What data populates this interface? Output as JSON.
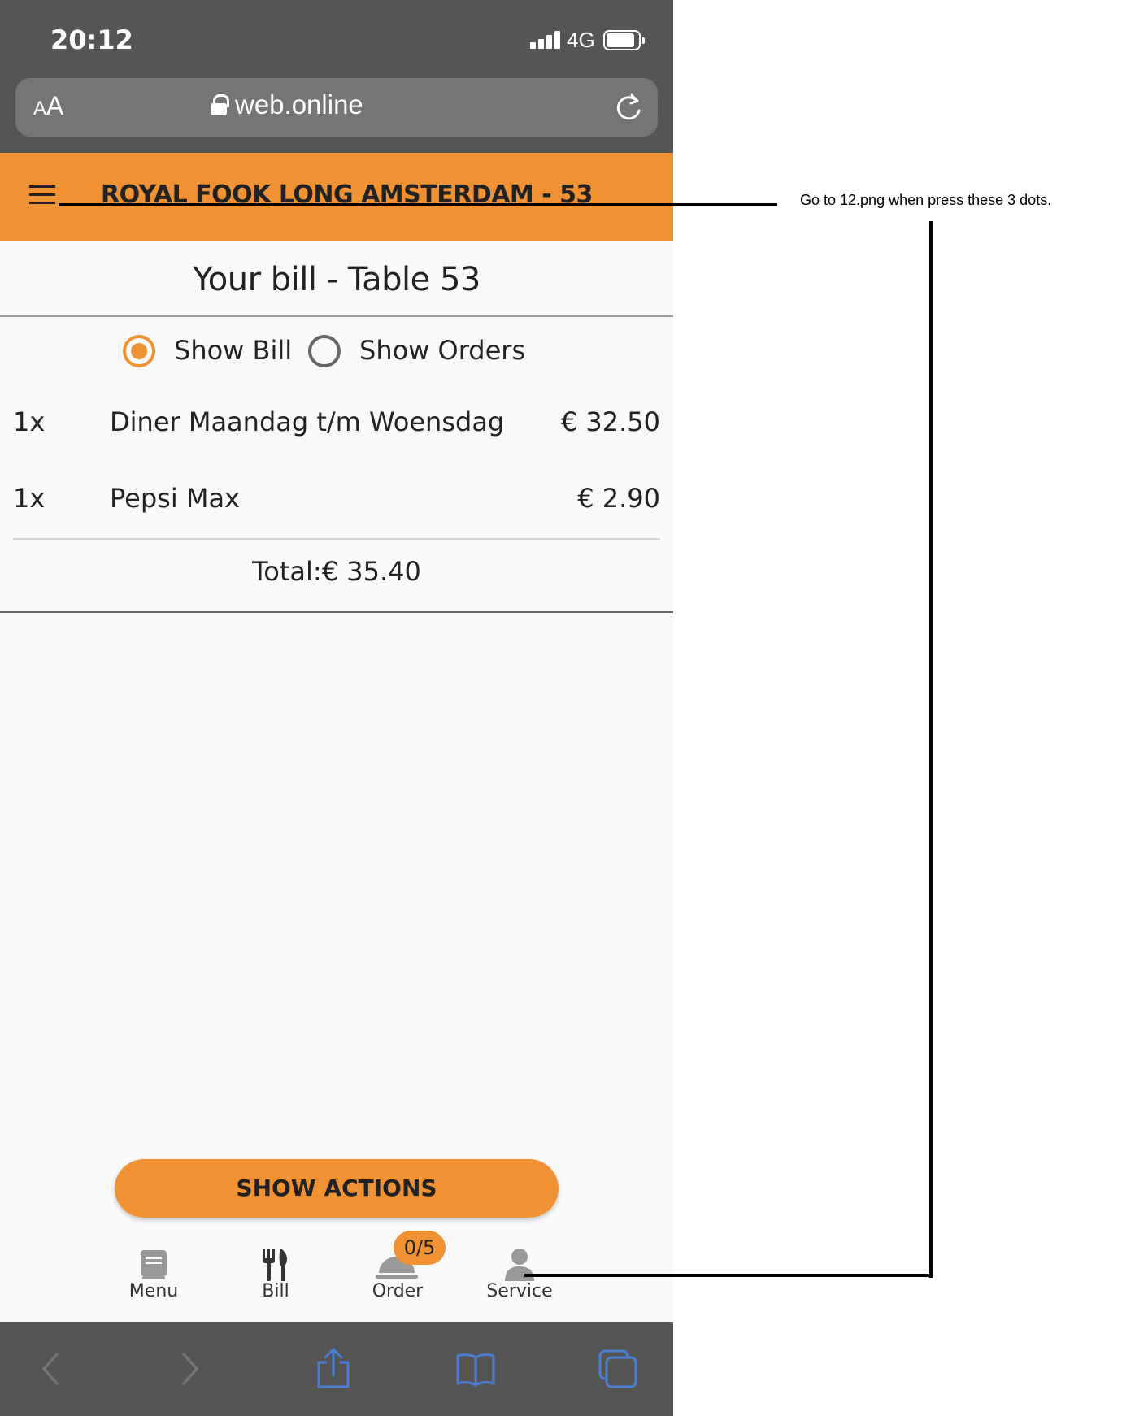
{
  "status_bar": {
    "time": "20:12",
    "network": "4G"
  },
  "browser": {
    "text_size_label_small": "A",
    "text_size_label_large": "A",
    "url": "web.online"
  },
  "app_header": {
    "title": "ROYAL FOOK LONG AMSTERDAM - 53"
  },
  "bill": {
    "title": "Your bill - Table 53",
    "view_options": [
      {
        "label": "Show Bill",
        "selected": true
      },
      {
        "label": "Show Orders",
        "selected": false
      }
    ],
    "items": [
      {
        "qty": "1x",
        "name": "Diner Maandag t/m Woensdag",
        "price": "€ 32.50"
      },
      {
        "qty": "1x",
        "name": "Pepsi Max",
        "price": "€ 2.90"
      }
    ],
    "total": "Total:€ 35.40"
  },
  "actions_button": {
    "label": "SHOW ACTIONS"
  },
  "tab_bar": {
    "tabs": [
      {
        "label": "Menu",
        "icon": "book-icon"
      },
      {
        "label": "Bill",
        "icon": "cutlery-icon"
      },
      {
        "label": "Order",
        "icon": "service-bell-icon"
      },
      {
        "label": "Service",
        "icon": "person-icon"
      }
    ],
    "order_badge": "0/5"
  },
  "safari_toolbar": {
    "icons": [
      "back-icon",
      "forward-icon",
      "share-icon",
      "bookmarks-icon",
      "tabs-icon"
    ]
  },
  "annotation": {
    "note": "Go to 12.png when press these 3 dots."
  },
  "colors": {
    "accent": "#f09233",
    "status_bar": "#555555",
    "url_bar": "#757575",
    "background": "#f9f9f9",
    "safari_icon": "#4a7fd6"
  }
}
